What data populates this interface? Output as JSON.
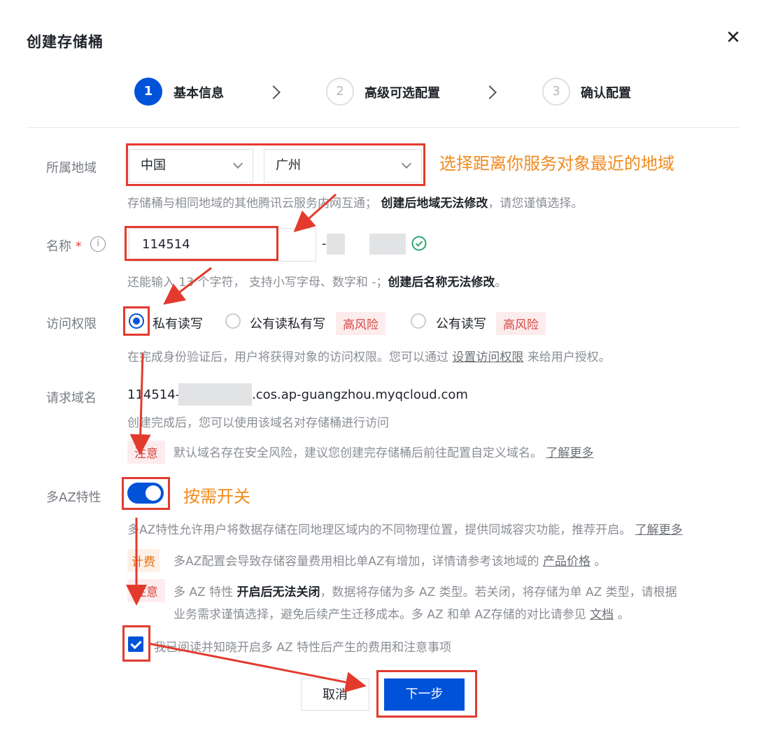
{
  "dialog": {
    "title": "创建存储桶"
  },
  "steps": [
    {
      "num": "1",
      "label": "基本信息"
    },
    {
      "num": "2",
      "label": "高级可选配置"
    },
    {
      "num": "3",
      "label": "确认配置"
    }
  ],
  "region": {
    "label": "所属地域",
    "country": "中国",
    "city": "广州",
    "help_prefix": "存储桶与相同地域的其他腾讯云服务内网互通；",
    "help_bold": "创建后地域无法修改",
    "help_suffix": "，请您谨慎选择。",
    "annotation": "选择距离你服务对象最近的地域"
  },
  "name": {
    "label": "名称",
    "required_mark": "*",
    "value": "114514",
    "suffix_dash": "-",
    "help_prefix": "还能输入 13 个字符， 支持小写字母、数字和 -；",
    "help_bold": "创建后名称无法修改",
    "help_suffix": "。"
  },
  "access": {
    "label": "访问权限",
    "options": [
      {
        "label": "私有读写",
        "selected": true
      },
      {
        "label": "公有读私有写",
        "tag": "高风险"
      },
      {
        "label": "公有读写",
        "tag": "高风险"
      }
    ],
    "help_prefix": "在完成身份验证后，用户将获得对象的访问权限。您可以通过",
    "help_link": "设置访问权限",
    "help_suffix": "来给用户授权。"
  },
  "domain": {
    "label": "请求域名",
    "prefix": "114514-",
    "suffix": ".cos.ap-guangzhou.myqcloud.com",
    "help": "创建完成后，您可以使用该域名对存储桶进行访问",
    "notice_tag": "注意",
    "notice_text": "默认域名存在安全风险，建议您创建完存储桶后前往配置自定义域名。",
    "notice_link": "了解更多"
  },
  "multi_az": {
    "label": "多AZ特性",
    "enabled": true,
    "annotation": "按需开关",
    "help": "多AZ特性允许用户将数据存储在同地理区域内的不同物理位置，提供同城容灾功能，推荐开启。",
    "help_link": "了解更多",
    "billing_tag": "计费",
    "billing_text": "多AZ配置会导致存储容量费用相比单AZ有增加，详情请参考该地域的",
    "billing_link": "产品价格",
    "billing_end": "。",
    "notice_tag": "注意",
    "notice_prefix": "多 AZ 特性",
    "notice_bold": "开启后无法关闭",
    "notice_line1_suffix": "，数据将存储为多 AZ 类型。若关闭，将存储为单 AZ 类型，请根据",
    "notice_line2": "业务需求谨慎选择，避免后续产生迁移成本。多 AZ 和单 AZ存储的对比请参见",
    "notice_link": "文档",
    "notice_end": "。",
    "ack_label": "我已阅读并知晓开启多 AZ 特性后产生的费用和注意事项",
    "ack_checked": true
  },
  "footer": {
    "cancel": "取消",
    "next": "下一步"
  },
  "colors": {
    "primary": "#0052d9",
    "annotation_red": "#e23b2e",
    "annotation_orange": "#f28a1e",
    "success": "#2ba471"
  }
}
